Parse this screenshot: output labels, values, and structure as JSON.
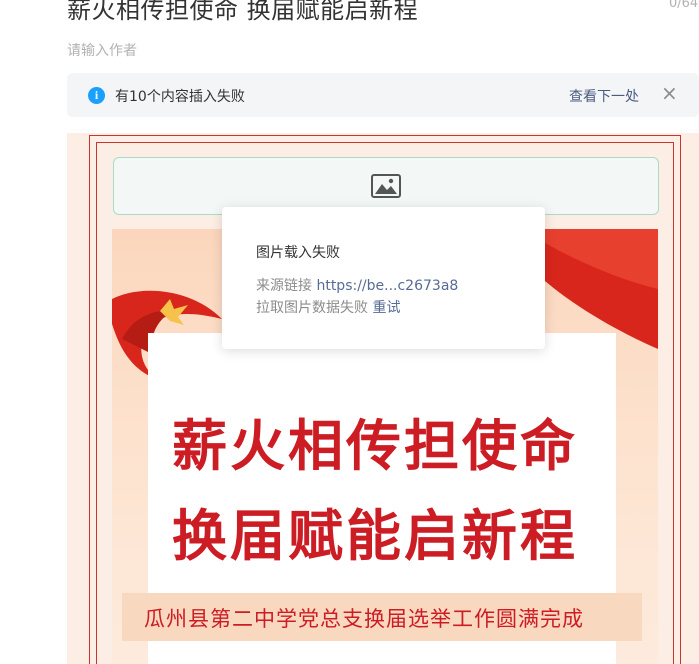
{
  "editor": {
    "title": "薪火相传担使命 换届赋能启新程",
    "char_count": "0/64",
    "author_placeholder": "请输入作者"
  },
  "notice": {
    "icon": "info-icon",
    "icon_glyph": "i",
    "message": "有10个内容插入失败",
    "next_label": "查看下一处",
    "close_glyph": "×"
  },
  "image_placeholder": {
    "icon": "image-icon"
  },
  "popover": {
    "title": "图片载入失败",
    "source_label": "来源链接",
    "source_link": "https://be...c2673a8",
    "fail_text": "拉取图片数据失败",
    "retry_label": "重试"
  },
  "poster": {
    "headline_1": "薪火相传担使命",
    "headline_2": "换届赋能启新程",
    "banner": "瓜州县第二中学党总支换届选举工作圆满完成"
  },
  "colors": {
    "accent_red": "#cc1c24",
    "info_blue": "#1aa0ff",
    "link_blue": "#576b95"
  }
}
